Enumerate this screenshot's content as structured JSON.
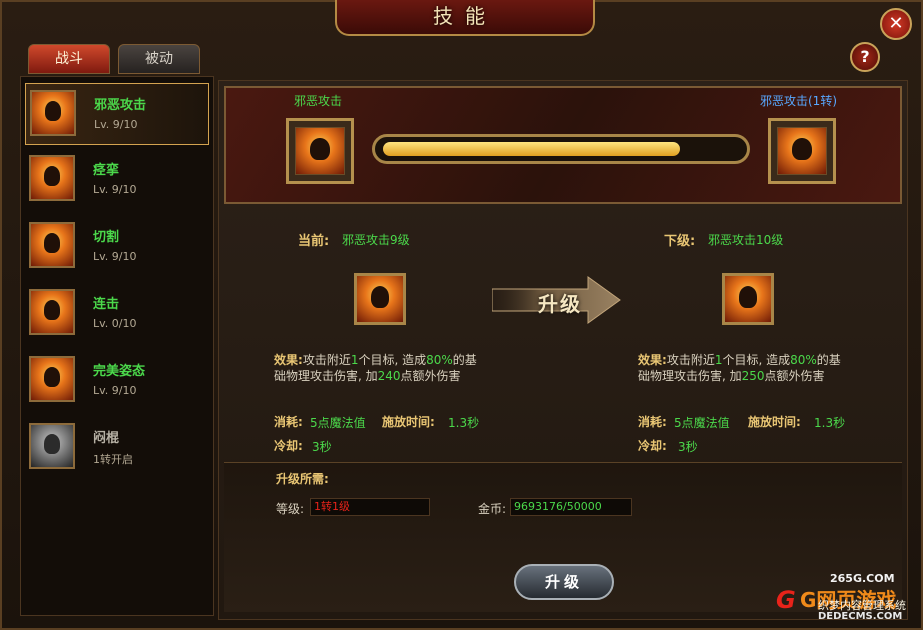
{
  "window": {
    "title": "技能"
  },
  "tabs": [
    {
      "label": "战斗"
    },
    {
      "label": "被动"
    }
  ],
  "skills": [
    {
      "name": "邪恶攻击",
      "level": "Lv. 9/10"
    },
    {
      "name": "痉挛",
      "level": "Lv. 9/10"
    },
    {
      "name": "切割",
      "level": "Lv. 9/10"
    },
    {
      "name": "连击",
      "level": "Lv. 0/10"
    },
    {
      "name": "完美姿态",
      "level": "Lv. 9/10"
    },
    {
      "name": "闷棍",
      "level": "1转开启"
    }
  ],
  "banner": {
    "left_name": "邪恶攻击",
    "right_name": "邪恶攻击(1转)",
    "progress_fraction": 0.9
  },
  "current": {
    "label": "当前:",
    "value": "邪恶攻击9级",
    "effect_label": "效果:",
    "effect_parts": [
      "攻击附近",
      "1",
      "个目标, 造成",
      "80%",
      "的基础物理攻击伤害, 加",
      "240",
      "点额外伤害"
    ],
    "cost_label": "消耗:",
    "cost_value": "5点魔法值",
    "cast_label": "施放时间:",
    "cast_value": "1.3秒",
    "cooldown_label": "冷却:",
    "cooldown_value": "3秒"
  },
  "next": {
    "label": "下级:",
    "value": "邪恶攻击10级",
    "effect_label": "效果:",
    "effect_parts": [
      "攻击附近",
      "1",
      "个目标, 造成",
      "80%",
      "的基础物理攻击伤害, 加",
      "250",
      "点额外伤害"
    ],
    "cost_label": "消耗:",
    "cost_value": "5点魔法值",
    "cast_label": "施放时间:",
    "cast_value": "1.3秒",
    "cooldown_label": "冷却:",
    "cooldown_value": "3秒"
  },
  "upgrade_arrow": "升级",
  "requirements": {
    "title": "升级所需:",
    "level_label": "等级:",
    "level_value": "1转1级",
    "gold_label": "金币:",
    "gold_value": "9693176/50000"
  },
  "upgrade_button": "升级",
  "watermark": {
    "top": "265G.COM",
    "main": "G网页游戏",
    "sub": "织梦内容管理系统",
    "url": "DEDECMS.COM"
  },
  "colors": {
    "green": "#4bd84b",
    "gold": "#e9c674",
    "blue": "#58a8ff",
    "red": "#e8231a"
  }
}
